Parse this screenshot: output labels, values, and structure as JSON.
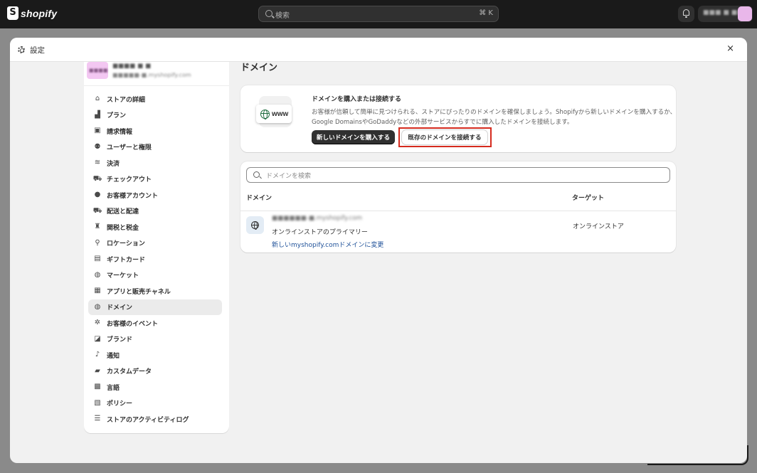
{
  "topbar": {
    "logo_text": "shopify",
    "search_placeholder": "検索",
    "search_shortcut": "⌘ K",
    "store_name": "■■■ ■ ■■",
    "colors": {
      "bar_bg": "#1a1a1a",
      "avatar": "#e9b7ea"
    }
  },
  "modal": {
    "title": "設定",
    "close_symbol": "×"
  },
  "sidebar": {
    "store": {
      "avatar_text": "■■■■",
      "name": "■■■■ ■ ■",
      "domain": "■■■■■-■.myshopify.com"
    },
    "items": [
      {
        "label": "ストアの詳細",
        "icon": "store-icon",
        "glyph": "⌂"
      },
      {
        "label": "プラン",
        "icon": "plan-chart-icon",
        "glyph": "▟"
      },
      {
        "label": "請求情報",
        "icon": "billing-receipt-icon",
        "glyph": "▣"
      },
      {
        "label": "ユーザーと権限",
        "icon": "users-icon",
        "glyph": "⚉"
      },
      {
        "label": "決済",
        "icon": "payment-icon",
        "glyph": "≋"
      },
      {
        "label": "チェックアウト",
        "icon": "checkout-cart-icon",
        "glyph": "⛟"
      },
      {
        "label": "お客様アカウント",
        "icon": "customer-account-icon",
        "glyph": "●"
      },
      {
        "label": "配送と配達",
        "icon": "shipping-truck-icon",
        "glyph": "⛟"
      },
      {
        "label": "関税と税金",
        "icon": "taxes-bag-icon",
        "glyph": "♜"
      },
      {
        "label": "ロケーション",
        "icon": "location-pin-icon",
        "glyph": "⚲"
      },
      {
        "label": "ギフトカード",
        "icon": "gift-card-icon",
        "glyph": "▤"
      },
      {
        "label": "マーケット",
        "icon": "markets-globe-icon",
        "glyph": "◍"
      },
      {
        "label": "アプリと販売チャネル",
        "icon": "apps-grid-icon",
        "glyph": "▦"
      },
      {
        "label": "ドメイン",
        "icon": "domain-globe-icon",
        "glyph": "◍",
        "active": true
      },
      {
        "label": "お客様のイベント",
        "icon": "customer-events-icon",
        "glyph": "✲"
      },
      {
        "label": "ブランド",
        "icon": "brand-icon",
        "glyph": "◪"
      },
      {
        "label": "通知",
        "icon": "notification-bell-icon",
        "glyph": "♪"
      },
      {
        "label": "カスタムデータ",
        "icon": "custom-data-icon",
        "glyph": "▰"
      },
      {
        "label": "言語",
        "icon": "language-icon",
        "glyph": "▩"
      },
      {
        "label": "ポリシー",
        "icon": "policy-icon",
        "glyph": "▧"
      },
      {
        "label": "ストアのアクティビティログ",
        "icon": "activity-log-list-icon",
        "glyph": "☰"
      }
    ]
  },
  "main": {
    "page_title": "ドメイン",
    "buy_card": {
      "illustration_text": "www",
      "title": "ドメインを購入または接続する",
      "description": "お客様が信頼して簡単に見つけられる、ストアにぴったりのドメインを確保しましょう。Shopifyから新しいドメインを購入するか、Google DomainsやGoDaddyなどの外部サービスからすでに購入したドメインを接続します。",
      "buy_button": "新しいドメインを購入する",
      "connect_button": "既存のドメインを接続する",
      "highlight_color": "#d52b1e"
    },
    "domains_card": {
      "search_placeholder": "ドメインを検索",
      "columns": [
        "ドメイン",
        "ターゲット"
      ],
      "rows": [
        {
          "domain": "■■■■■■-■.myshopify.com",
          "role": "オンラインストアのプライマリー",
          "change_link": "新しいmyshopify.comドメインに変更",
          "target": "オンラインストア"
        }
      ]
    }
  }
}
